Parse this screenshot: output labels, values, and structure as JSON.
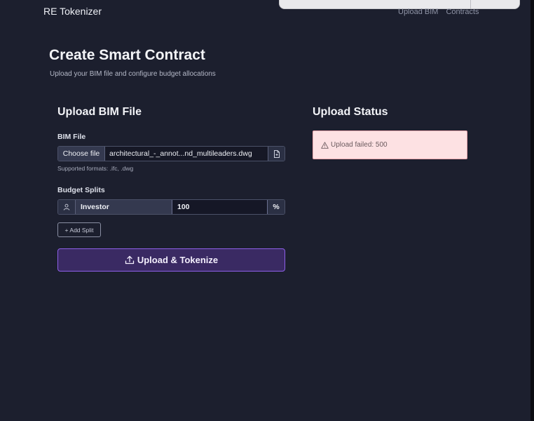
{
  "app": {
    "brand": "RE Tokenizer"
  },
  "nav": {
    "items": [
      "Upload BIM",
      "Contracts"
    ]
  },
  "page": {
    "title": "Create Smart Contract",
    "subtitle": "Upload your BIM file and configure budget allocations"
  },
  "upload_card": {
    "title": "Upload BIM File",
    "file_label": "BIM File",
    "choose_label": "Choose file",
    "file_name": "architectural_-_annot...nd_multileaders.dwg",
    "supported_formats": "Supported formats: .ifc, .dwg",
    "budget_label": "Budget Splits",
    "splits": [
      {
        "name": "Investor",
        "value": "100",
        "unit": "%"
      }
    ],
    "add_split_label": "+ Add Split",
    "submit_label": "Upload & Tokenize"
  },
  "status_card": {
    "title": "Upload Status",
    "message": "Upload failed: 500"
  },
  "colors": {
    "background": "#1c1f2e",
    "accent": "#8d5fe8",
    "error_bg": "#fde1e3"
  }
}
